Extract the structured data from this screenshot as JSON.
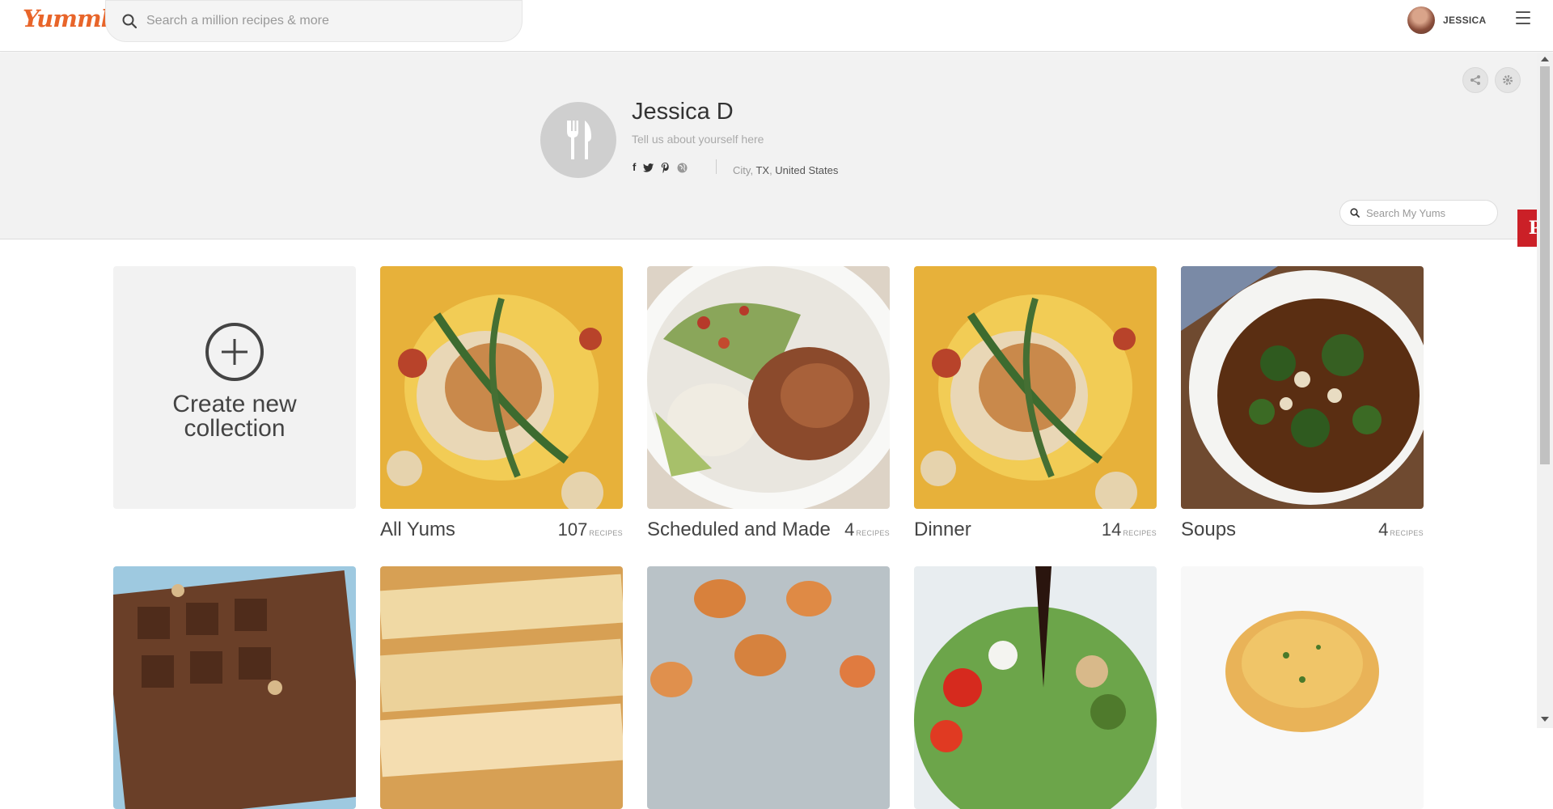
{
  "header": {
    "logo": "Yummly",
    "search_placeholder": "Search a million recipes & more",
    "username": "JESSICA"
  },
  "profile": {
    "name": "Jessica D",
    "bio_placeholder": "Tell us about yourself here",
    "location": {
      "city": "City",
      "state": "TX",
      "country": "United States"
    },
    "social_icons": [
      "facebook-icon",
      "twitter-icon",
      "pinterest-icon",
      "globe-icon"
    ],
    "yums_search_placeholder": "Search My Yums"
  },
  "collections": {
    "create_label": "Create new collection",
    "count_unit": "RECIPES",
    "items": [
      {
        "title": "All Yums",
        "count": "107"
      },
      {
        "title": "Scheduled and Made",
        "count": "4"
      },
      {
        "title": "Dinner",
        "count": "14"
      },
      {
        "title": "Soups",
        "count": "4"
      }
    ]
  },
  "colors": {
    "brand": "#e8652a",
    "pinterest": "#cb2027",
    "profile_bg": "#f2f2f2"
  },
  "pinterest_button": "P"
}
